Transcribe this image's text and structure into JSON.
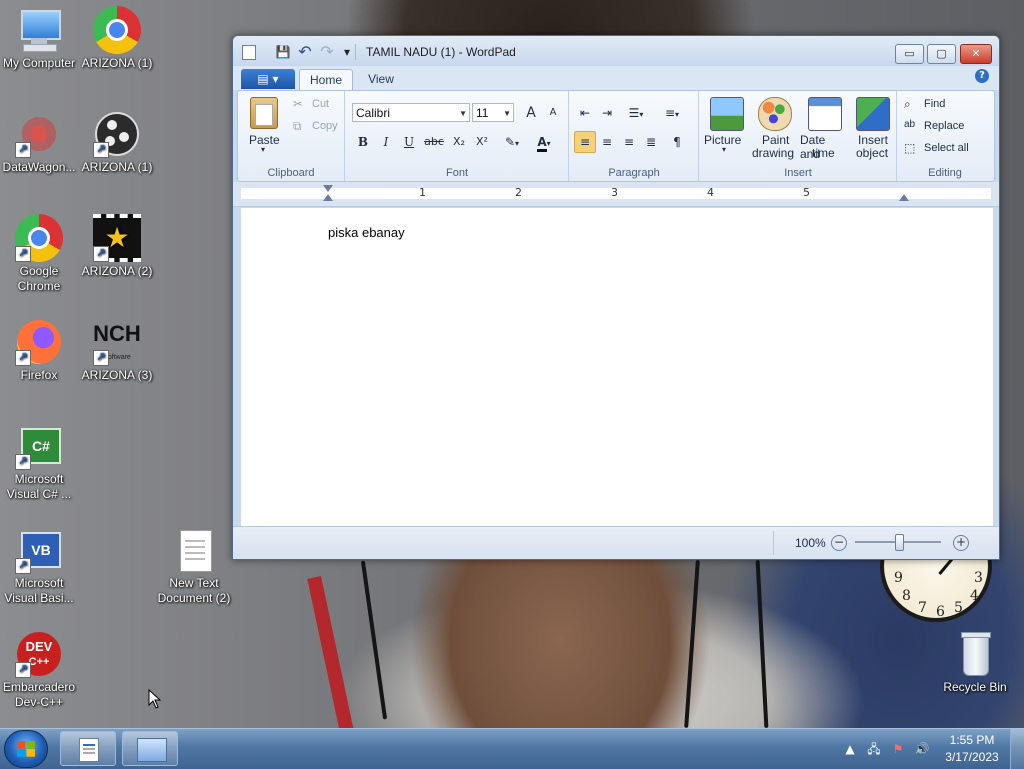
{
  "desktop": {
    "icons": [
      {
        "label": "My Computer"
      },
      {
        "label": "ARIZONA (1)"
      },
      {
        "label": "DataWagon..."
      },
      {
        "label": "ARIZONA (1)"
      },
      {
        "label": "Google Chrome"
      },
      {
        "label": "ARIZONA (2)"
      },
      {
        "label": "Firefox"
      },
      {
        "label": "ARIZONA (3)"
      },
      {
        "label": "Microsoft Visual C# ..."
      },
      {
        "label": "Microsoft Visual Basi..."
      },
      {
        "label": "New Text Document (2)"
      },
      {
        "label": "Embarcadero Dev-C++"
      },
      {
        "label": "Recycle Bin"
      }
    ],
    "icon_glyphs": {
      "cs": "C#",
      "vb": "VB",
      "dev": "DEV",
      "devplus": "C++",
      "nch": "NCH",
      "nch_sub": "Software"
    }
  },
  "window": {
    "title": "TAMIL NADU (1) - WordPad",
    "controls": {
      "minimize": "▭",
      "maximize": "▢",
      "close": "✕"
    },
    "qat": {
      "save": "💾",
      "undo": "↶",
      "redo": "↷",
      "customize": "▾"
    },
    "tabs": {
      "home": "Home",
      "view": "View"
    },
    "help": "?"
  },
  "ribbon": {
    "clipboard": {
      "label": "Clipboard",
      "paste": "Paste",
      "cut": "Cut",
      "copy": "Copy"
    },
    "font": {
      "label": "Font",
      "family": "Calibri",
      "size": "11",
      "bold": "B",
      "italic": "I",
      "underline": "U",
      "strike": "abc",
      "subscript": "X₂",
      "superscript": "X²",
      "grow": "A",
      "shrink": "A",
      "color": "A"
    },
    "paragraph": {
      "label": "Paragraph"
    },
    "insert": {
      "label": "Insert",
      "picture": "Picture",
      "paint_drawing": [
        "Paint",
        "drawing"
      ],
      "date_time": [
        "Date and",
        "time"
      ],
      "insert_object": [
        "Insert",
        "object"
      ]
    },
    "editing": {
      "label": "Editing",
      "find": "Find",
      "replace": "Replace",
      "select_all": "Select all"
    }
  },
  "ruler": {
    "marks": [
      "1",
      "2",
      "3",
      "4",
      "5"
    ]
  },
  "document": {
    "text": "piska ebanay"
  },
  "statusbar": {
    "zoom": "100%",
    "zoom_out": "−",
    "zoom_in": "+"
  },
  "gadget": {
    "clock_numbers": [
      "9",
      "3",
      "8",
      "7",
      "6",
      "5",
      "4"
    ]
  },
  "taskbar": {
    "time": "1:55 PM",
    "date": "3/17/2023"
  },
  "colors": {
    "ribbon_accent": "#2f6dc6",
    "close_button": "#c6402b",
    "align_left_active": "#f5d27a"
  }
}
